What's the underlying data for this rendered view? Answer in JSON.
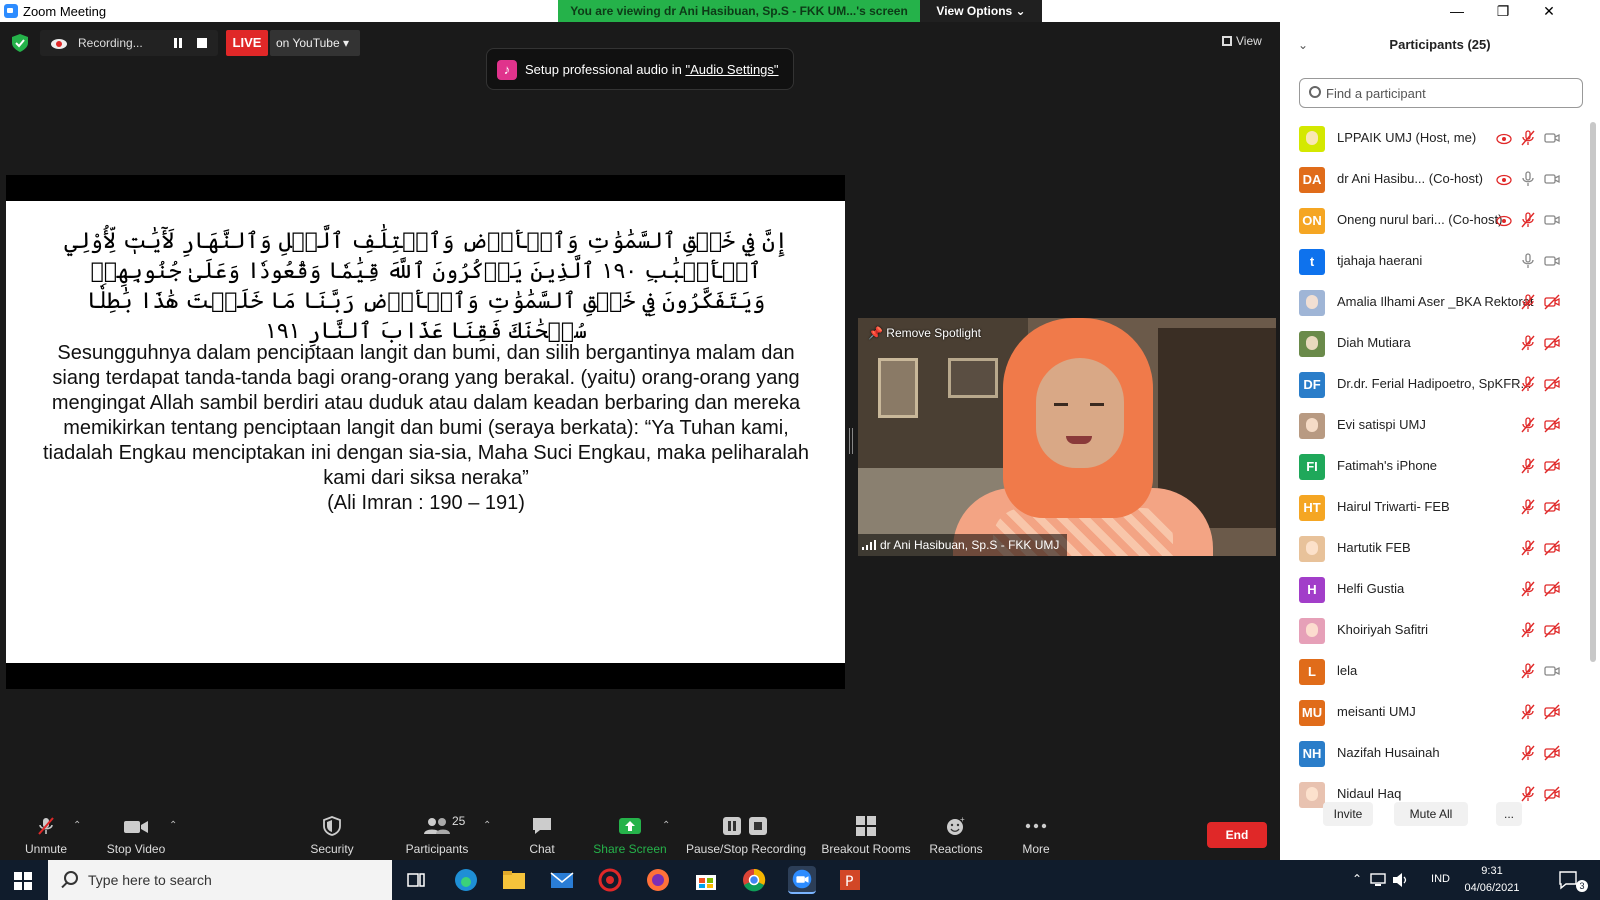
{
  "window": {
    "title": "Zoom Meeting",
    "minimize": "—",
    "restore": "❐",
    "close": "✕"
  },
  "banner": {
    "viewing": "You are viewing dr Ani Hasibuan, Sp.S - FKK UM...'s screen",
    "view_options": "View Options ⌄"
  },
  "topbar": {
    "recording_label": "Recording...",
    "live_label": "LIVE",
    "live_destination": "on YouTube ▾",
    "view_label": "View"
  },
  "audio_tip": {
    "text": "Setup professional audio in ",
    "link": "\"Audio Settings\""
  },
  "slide": {
    "arabic": "إِنَّ فِي خَلۡقِ ٱلسَّمَٰوَٰتِ وَٱلۡأَرۡضِ وَٱخۡتِلَٰفِ ٱلَّيۡلِ وَٱلنَّهَارِ لَأٓيَٰتٖ لِّأُوْلِي ٱلۡأَلۡبَٰبِ ١٩٠ ٱلَّذِينَ يَذۡكُرُونَ ٱللَّهَ قِيَٰمٗا وَقُعُودٗا وَعَلَىٰ جُنُوبِهِمۡ وَيَتَفَكَّرُونَ فِي خَلۡقِ ٱلسَّمَٰوَٰتِ وَٱلۡأَرۡضِ رَبَّنَا مَا خَلَقۡتَ هَٰذَا بَٰطِلٗا سُبۡحَٰنَكَ فَقِنَا عَذَابَ ٱلنَّارِ ١٩١",
    "translation": "Sesungguhnya dalam penciptaan langit dan bumi, dan silih bergantinya malam dan siang terdapat tanda-tanda bagi orang-orang yang berakal. (yaitu) orang-orang yang mengingat Allah sambil berdiri atau duduk atau dalam keadan berbaring dan mereka memikirkan tentang penciptaan langit dan bumi (seraya berkata): “Ya Tuhan kami, tiadalah Engkau menciptakan ini dengan sia-sia, Maha Suci Engkau, maka peliharalah kami dari siksa neraka”",
    "reference": "(Ali Imran : 190 – 191)"
  },
  "video": {
    "remove_spotlight": "Remove Spotlight",
    "speaker_name": "dr Ani Hasibuan, Sp.S - FKK UMJ"
  },
  "toolbar": {
    "unmute": "Unmute",
    "stop_video": "Stop Video",
    "security": "Security",
    "participants": "Participants",
    "participants_count": "25",
    "chat": "Chat",
    "share_screen": "Share Screen",
    "pause_stop_recording": "Pause/Stop Recording",
    "breakout_rooms": "Breakout Rooms",
    "reactions": "Reactions",
    "more": "More",
    "end": "End"
  },
  "panel": {
    "title": "Participants (25)",
    "search_placeholder": "Find a participant",
    "participants": [
      {
        "name": "LPPAIK UMJ (Host, me)",
        "avatar": "",
        "avatar_color": "#d4e800",
        "photo": true,
        "rec": true,
        "mic": "muted",
        "cam": "on"
      },
      {
        "name": "dr Ani Hasibu... (Co-host)",
        "avatar": "DA",
        "avatar_color": "#e06c1a",
        "photo": false,
        "rec": true,
        "mic": "on",
        "cam": "on"
      },
      {
        "name": "Oneng nurul bari...  (Co-host)",
        "avatar": "ON",
        "avatar_color": "#f5a623",
        "photo": false,
        "rec": true,
        "mic": "muted",
        "cam": "on"
      },
      {
        "name": "tjahaja haerani",
        "avatar": "t",
        "avatar_color": "#0e72ed",
        "photo": false,
        "rec": false,
        "mic": "on",
        "cam": "on"
      },
      {
        "name": "Amalia Ilhami Aser _BKA Rektorat",
        "avatar": "",
        "avatar_color": "#9fb5d6",
        "photo": true,
        "rec": false,
        "mic": "muted",
        "cam": "off"
      },
      {
        "name": "Diah Mutiara",
        "avatar": "",
        "avatar_color": "#6a8a4a",
        "photo": true,
        "rec": false,
        "mic": "muted",
        "cam": "off"
      },
      {
        "name": "Dr.dr. Ferial Hadipoetro, SpKFR...",
        "avatar": "DF",
        "avatar_color": "#2a7dc9",
        "photo": false,
        "rec": false,
        "mic": "muted",
        "cam": "off"
      },
      {
        "name": "Evi satispi UMJ",
        "avatar": "",
        "avatar_color": "#b89a82",
        "photo": true,
        "rec": false,
        "mic": "muted",
        "cam": "off"
      },
      {
        "name": "Fatimah's iPhone",
        "avatar": "FI",
        "avatar_color": "#1fa85a",
        "photo": false,
        "rec": false,
        "mic": "muted",
        "cam": "off"
      },
      {
        "name": "Hairul Triwarti- FEB",
        "avatar": "HT",
        "avatar_color": "#f5a623",
        "photo": false,
        "rec": false,
        "mic": "muted",
        "cam": "off"
      },
      {
        "name": "Hartutik FEB",
        "avatar": "",
        "avatar_color": "#e8c29a",
        "photo": true,
        "rec": false,
        "mic": "muted",
        "cam": "off"
      },
      {
        "name": "Helfi Gustia",
        "avatar": "H",
        "avatar_color": "#a23ec9",
        "photo": false,
        "rec": false,
        "mic": "muted",
        "cam": "off"
      },
      {
        "name": "Khoiriyah Safitri",
        "avatar": "",
        "avatar_color": "#e6a0b8",
        "photo": true,
        "rec": false,
        "mic": "muted",
        "cam": "off"
      },
      {
        "name": "lela",
        "avatar": "L",
        "avatar_color": "#e06c1a",
        "photo": false,
        "rec": false,
        "mic": "muted",
        "cam": "on"
      },
      {
        "name": "meisanti UMJ",
        "avatar": "MU",
        "avatar_color": "#e06c1a",
        "photo": false,
        "rec": false,
        "mic": "muted",
        "cam": "off"
      },
      {
        "name": "Nazifah Husainah",
        "avatar": "NH",
        "avatar_color": "#2a7dc9",
        "photo": false,
        "rec": false,
        "mic": "muted",
        "cam": "off"
      },
      {
        "name": "Nidaul Haq",
        "avatar": "",
        "avatar_color": "#e8c2b0",
        "photo": true,
        "rec": false,
        "mic": "muted",
        "cam": "off"
      }
    ],
    "invite": "Invite",
    "mute_all": "Mute All",
    "more": "..."
  },
  "taskbar": {
    "search_placeholder": "Type here to search",
    "language": "IND",
    "time": "9:31",
    "date": "04/06/2021",
    "notifications": "3"
  }
}
